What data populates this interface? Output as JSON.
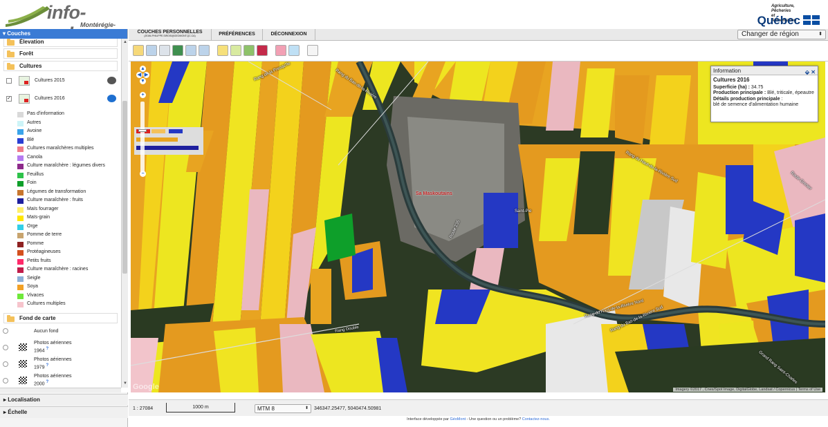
{
  "header": {
    "logo_title": "info-sols.ca",
    "logo_sub": "Montérégie-Est",
    "gov_line1": "Agriculture, Pêcheries",
    "gov_line2": "et Alimentation",
    "gov_name": "Québec"
  },
  "sidebar": {
    "head": "▾ Couches",
    "groups": {
      "elevation": "Élevation",
      "foret": "Forêt",
      "cultures": "Cultures",
      "fond": "Fond de carte"
    },
    "layers": {
      "c2015": "Cultures 2015",
      "c2016": "Cultures 2016"
    },
    "legend": [
      {
        "label": "Pas d'information",
        "color": "#d9d9d9"
      },
      {
        "label": "Autres",
        "color": "#cdf4f7"
      },
      {
        "label": "Avoine",
        "color": "#3aa4ea"
      },
      {
        "label": "Blé",
        "color": "#2a3fd4"
      },
      {
        "label": "Cultures maraîchères multiples",
        "color": "#f07c8a"
      },
      {
        "label": "Canola",
        "color": "#b67bf0"
      },
      {
        "label": "Culture maraîchère : légumes divers",
        "color": "#8d2a8a"
      },
      {
        "label": "Feuillus",
        "color": "#2ec24a"
      },
      {
        "label": "Foin",
        "color": "#0e9f2a"
      },
      {
        "label": "Légumes de transformation",
        "color": "#c8762e"
      },
      {
        "label": "Culture maraîchère : fruits",
        "color": "#1e1f9e"
      },
      {
        "label": "Maïs fourrager",
        "color": "#fff06a"
      },
      {
        "label": "Maïs-grain",
        "color": "#ffe600"
      },
      {
        "label": "Orge",
        "color": "#33cfe8"
      },
      {
        "label": "Pomme de terre",
        "color": "#c8a46e"
      },
      {
        "label": "Pomme",
        "color": "#8e2121"
      },
      {
        "label": "Protéagineuses",
        "color": "#d4501e"
      },
      {
        "label": "Petits fruits",
        "color": "#ff2a6a"
      },
      {
        "label": "Culture maraîchère : racines",
        "color": "#c01c4a"
      },
      {
        "label": "Seigle",
        "color": "#8cb0d8"
      },
      {
        "label": "Soya",
        "color": "#f2a126"
      },
      {
        "label": "Vivaces",
        "color": "#6fe83a"
      },
      {
        "label": "Cultures multiples",
        "color": "#f6c4cc"
      }
    ],
    "basemaps": {
      "aucun": "Aucun fond",
      "p1964a": "Photos aériennes",
      "p1964b": "1964",
      "p1979a": "Photos aériennes",
      "p1979b": "1979",
      "p2000a": "Photos aériennes",
      "p2000b": "2000"
    },
    "localisation": "▸ Localisation",
    "echelle": "▸ Échelle"
  },
  "topbar": {
    "tab1": "COUCHES PERSONNELLES",
    "tab1_sub": "(JEAN-PHILIPPE.SIROIS@GEOMONT.QC.CA)",
    "tab2": "PRÉFÉRENCES",
    "tab3": "DÉCONNEXION",
    "region": "Changer de région"
  },
  "info": {
    "head": "Information",
    "title": "Cultures 2016",
    "sup_label": "Superficie (ha) :",
    "sup_value": " 34.75",
    "prod_label": "Production principale :",
    "prod_value": " Blé, triticale, épeautre",
    "det_label": "Détails production principale",
    "det_value": "blé de semence d'alimentation humaine"
  },
  "map": {
    "town": "Sa Maskoutains",
    "saint_pie": "Saint-Pie",
    "attrib": "Imagery ©2017 , Cnes/Spot Image, DigitalGlobe, Landsat / Copernicus | Terms of Use",
    "google": "Google",
    "roads": {
      "r1": "Rang de la Presqu'île",
      "r2": "Rang du Bas-de-la-Rivière",
      "r3": "Rang Double",
      "r4": "Rang du Haut-de-la-Rivière Nord",
      "r5": "Rang du Bas-de-la-Rivière Sud",
      "r6": "Grand Rang Saint-Charles",
      "r7": "Route Grenier",
      "r8": "Rang du Haut-de-la-Rivière Sud",
      "r9": "Route 235"
    }
  },
  "status": {
    "scale": "1 : 27084",
    "scalebar": "1000 m",
    "proj": "MTM 8",
    "coords": "346347.25477, 5040474.50981"
  },
  "footer": {
    "text1": "Interface développée par ",
    "link1": "GéoMont",
    "text2": " - Une question ou un problème? ",
    "link2": "Contactez-nous."
  }
}
